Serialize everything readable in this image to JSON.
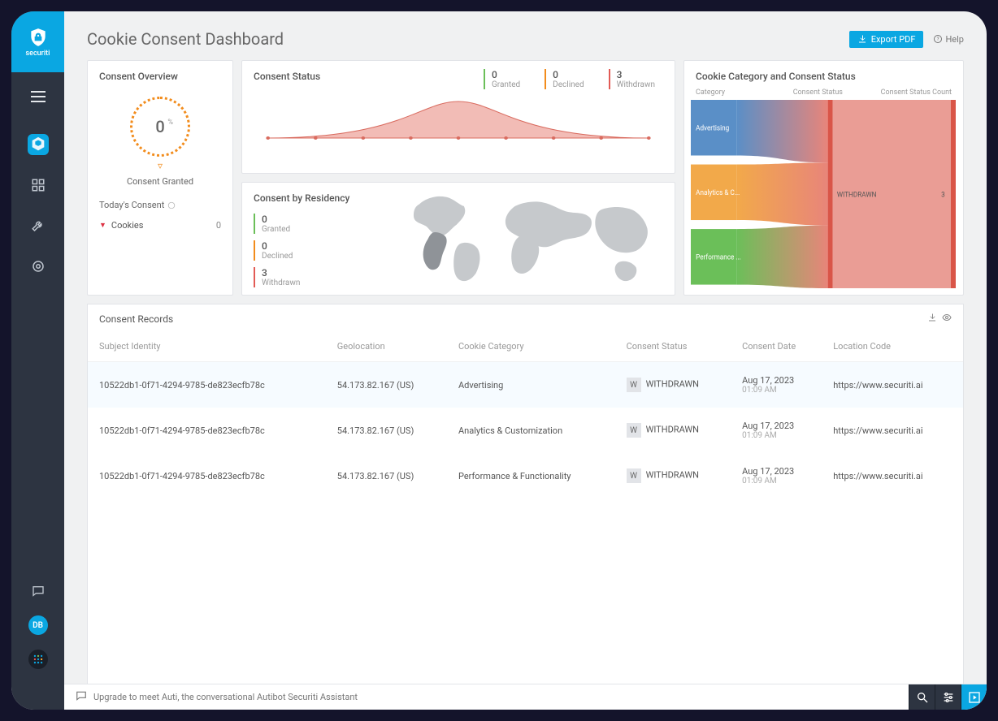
{
  "brand": "securiti",
  "header": {
    "title": "Cookie Consent Dashboard",
    "export_label": "Export PDF",
    "help_label": "Help"
  },
  "overview": {
    "title": "Consent Overview",
    "percent_value": "0",
    "percent_suffix": "%",
    "label": "Consent Granted",
    "today_title": "Today's Consent",
    "cookies_label": "Cookies",
    "cookies_value": "0"
  },
  "consent_status": {
    "title": "Consent Status",
    "stats": [
      {
        "value": "0",
        "label": "Granted"
      },
      {
        "value": "0",
        "label": "Declined"
      },
      {
        "value": "3",
        "label": "Withdrawn"
      }
    ]
  },
  "residency": {
    "title": "Consent by Residency",
    "stats": [
      {
        "value": "0",
        "label": "Granted"
      },
      {
        "value": "0",
        "label": "Declined"
      },
      {
        "value": "3",
        "label": "Withdrawn"
      }
    ]
  },
  "sankey": {
    "title": "Cookie Category and Consent Status",
    "cols": [
      "Category",
      "Consent Status",
      "Consent Status Count"
    ],
    "cats": [
      "Advertising",
      "Analytics & C...",
      "Performance ..."
    ],
    "status": "WITHDRAWN",
    "count": "3"
  },
  "records": {
    "title": "Consent Records",
    "columns": [
      "Subject Identity",
      "Geolocation",
      "Cookie Category",
      "Consent Status",
      "Consent Date",
      "Location Code"
    ],
    "rows": [
      {
        "id": "10522db1-0f71-4294-9785-de823ecfb78c",
        "geo": "54.173.82.167 (US)",
        "cat": "Advertising",
        "status": "WITHDRAWN",
        "date": "Aug 17, 2023",
        "time": "01:09 AM",
        "loc": "https://www.securiti.ai"
      },
      {
        "id": "10522db1-0f71-4294-9785-de823ecfb78c",
        "geo": "54.173.82.167 (US)",
        "cat": "Analytics & Customization",
        "status": "WITHDRAWN",
        "date": "Aug 17, 2023",
        "time": "01:09 AM",
        "loc": "https://www.securiti.ai"
      },
      {
        "id": "10522db1-0f71-4294-9785-de823ecfb78c",
        "geo": "54.173.82.167 (US)",
        "cat": "Performance & Functionality",
        "status": "WITHDRAWN",
        "date": "Aug 17, 2023",
        "time": "01:09 AM",
        "loc": "https://www.securiti.ai"
      }
    ]
  },
  "avatar": "DB",
  "bottom_bar": {
    "text": "Upgrade to meet Auti, the conversational Autibot Securiti Assistant"
  },
  "chart_data": {
    "type": "sankey",
    "title": "Cookie Category and Consent Status",
    "left_nodes": [
      "Advertising",
      "Analytics & Customization",
      "Performance & Functionality"
    ],
    "right_node": "WITHDRAWN",
    "flows": [
      {
        "from": "Advertising",
        "to": "WITHDRAWN",
        "value": 1
      },
      {
        "from": "Analytics & Customization",
        "to": "WITHDRAWN",
        "value": 1
      },
      {
        "from": "Performance & Functionality",
        "to": "WITHDRAWN",
        "value": 1
      }
    ],
    "total": 3
  }
}
